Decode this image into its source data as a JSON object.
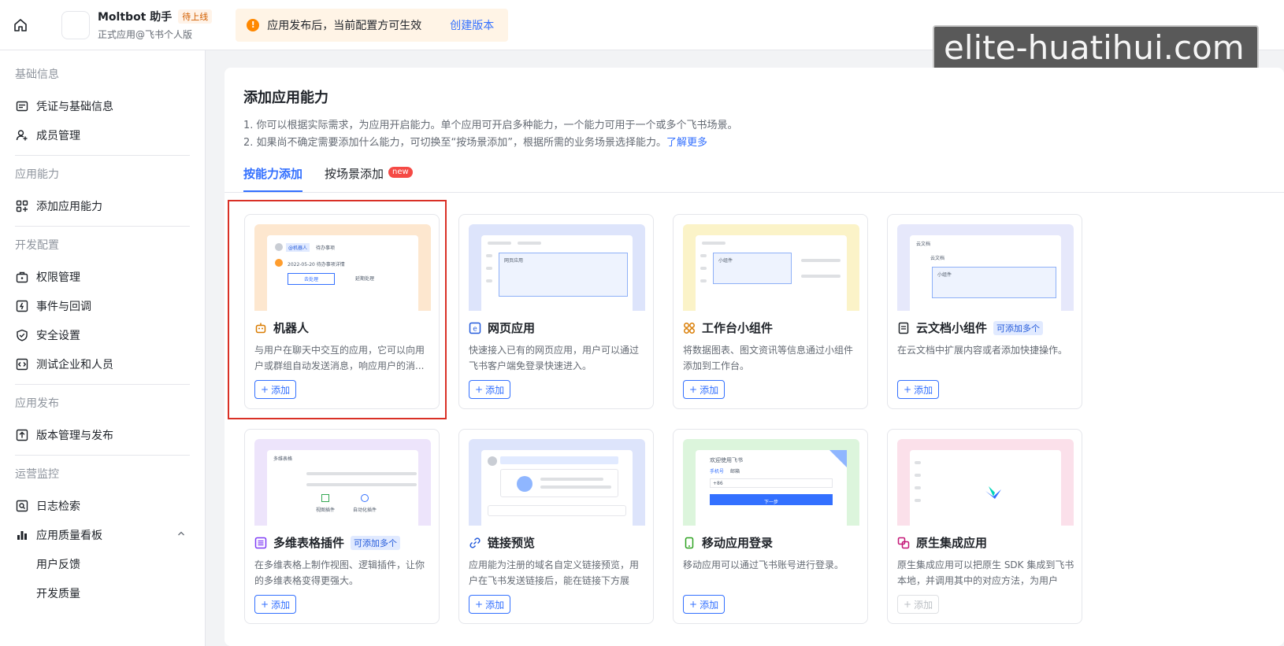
{
  "topbar": {
    "app_name": "Moltbot 助手",
    "status_tag": "待上线",
    "app_subtitle": "正式应用@飞书个人版",
    "notice_text": "应用发布后，当前配置方可生效",
    "notice_link": "创建版本",
    "watermark": "elite-huatihui.com"
  },
  "sidebar": {
    "sec_basic": "基础信息",
    "credentials": "凭证与基础信息",
    "members": "成员管理",
    "sec_ability": "应用能力",
    "add_ability": "添加应用能力",
    "sec_dev": "开发配置",
    "permissions": "权限管理",
    "events": "事件与回调",
    "security": "安全设置",
    "test_org": "测试企业和人员",
    "sec_release": "应用发布",
    "version": "版本管理与发布",
    "sec_ops": "运营监控",
    "logs": "日志检索",
    "quality": "应用质量看板",
    "feedback": "用户反馈",
    "dev_quality": "开发质量"
  },
  "main": {
    "title": "添加应用能力",
    "desc1": "1. 你可以根据实际需求，为应用开启能力。单个应用可开启多种能力，一个能力可用于一个或多个飞书场景。",
    "desc2": "2. 如果尚不确定需要添加什么能力，可切换至“按场景添加”，根据所需的业务场景选择能力。",
    "desc2_link": "了解更多",
    "tab_by_ability": "按能力添加",
    "tab_by_scene": "按场景添加",
    "new_badge": "new",
    "add_label": "添加"
  },
  "cards": [
    {
      "title": "机器人",
      "desc": "与用户在聊天中交互的应用，它可以向用户或群组自动发送消息，响应用户的消...",
      "icon": "robot-icon"
    },
    {
      "title": "网页应用",
      "desc": "快速接入已有的网页应用，用户可以通过飞书客户端免登录快速进入。",
      "icon": "web-app-icon"
    },
    {
      "title": "工作台小组件",
      "desc": "将数据图表、图文资讯等信息通过小组件添加到工作台。",
      "icon": "widget-icon"
    },
    {
      "title": "云文档小组件",
      "tag": "可添加多个",
      "desc": "在云文档中扩展内容或者添加快捷操作。",
      "icon": "doc-icon"
    },
    {
      "title": "多维表格插件",
      "tag": "可添加多个",
      "desc": "在多维表格上制作视图、逻辑插件，让你的多维表格变得更强大。",
      "icon": "bitable-icon"
    },
    {
      "title": "链接预览",
      "desc": "应用能为注册的域名自定义链接预览，用户在飞书发送链接后，能在链接下方展示...",
      "icon": "link-icon"
    },
    {
      "title": "移动应用登录",
      "desc": "移动应用可以通过飞书账号进行登录。",
      "icon": "mobile-icon"
    },
    {
      "title": "原生集成应用",
      "desc": "原生集成应用可以把原生 SDK 集成到飞书本地，并调用其中的对应方法，为用户提...",
      "icon": "native-icon"
    }
  ],
  "thumbs": {
    "bot_chat_tag": "@机器人",
    "bot_chat_msg": "待办事项",
    "bot_date_line": "2022-05-20 待办事项详情",
    "bot_btn1": "去处理",
    "bot_btn2": "延期处理",
    "web_box": "网页应用",
    "widget_box": "小组件",
    "doc_header": "云文档",
    "doc_title": "云文档",
    "doc_box": "小组件",
    "bitable_header": "多维表格",
    "bitable_view": "视图插件",
    "bitable_auto": "自动化插件",
    "login_title": "欢迎使用飞书",
    "login_tab1": "手机号",
    "login_tab2": "邮箱",
    "login_prefix": "+86",
    "login_next": "下一步"
  },
  "colors": {
    "brand": "#3370ff",
    "highlight": "#d93026",
    "warn": "#ff8800"
  }
}
